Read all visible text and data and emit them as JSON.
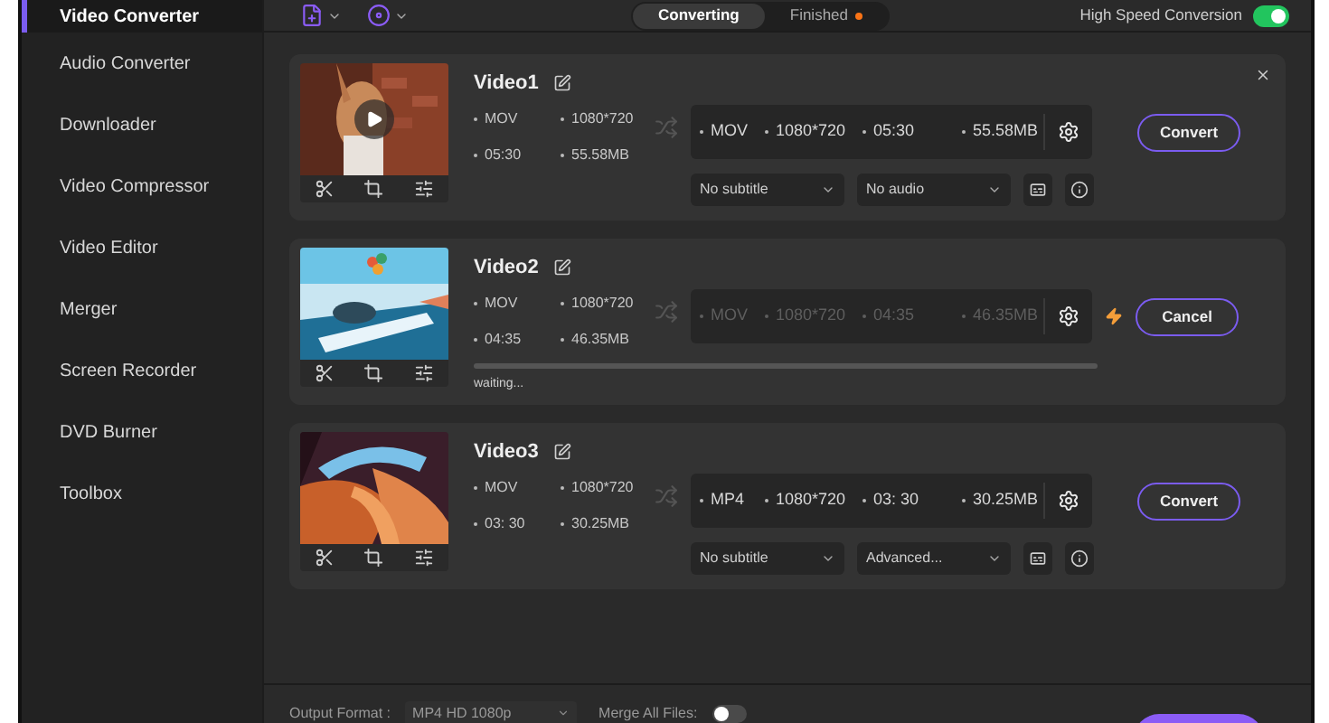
{
  "sidebar": {
    "items": [
      {
        "label": "Video Converter",
        "selected": true
      },
      {
        "label": "Audio Converter",
        "selected": false
      },
      {
        "label": "Downloader",
        "selected": false
      },
      {
        "label": "Video Compressor",
        "selected": false
      },
      {
        "label": "Video Editor",
        "selected": false
      },
      {
        "label": "Merger",
        "selected": false
      },
      {
        "label": "Screen Recorder",
        "selected": false
      },
      {
        "label": "DVD Burner",
        "selected": false
      },
      {
        "label": "Toolbox",
        "selected": false
      }
    ]
  },
  "toolbar": {
    "tabs": [
      {
        "label": "Converting",
        "selected": true,
        "badge": false
      },
      {
        "label": "Finished",
        "selected": false,
        "badge": true
      }
    ],
    "high_speed": {
      "label": "High Speed Conversion",
      "on": true
    }
  },
  "videos": [
    {
      "kind": "idle",
      "title": "Video1",
      "closable": true,
      "playing_overlay": true,
      "source": {
        "format": "MOV",
        "resolution": "1080*720",
        "duration": "05:30",
        "size": "55.58MB"
      },
      "target": {
        "format": "MOV",
        "resolution": "1080*720",
        "duration": "05:30",
        "size": "55.58MB"
      },
      "subtitle": "No subtitle",
      "audio": "No audio",
      "button": "Convert"
    },
    {
      "kind": "converting",
      "title": "Video2",
      "source": {
        "format": "MOV",
        "resolution": "1080*720",
        "duration": "04:35",
        "size": "46.35MB"
      },
      "target": {
        "format": "MOV",
        "resolution": "1080*720",
        "duration": "04:35",
        "size": "46.35MB"
      },
      "status": "waiting...",
      "level": 0,
      "accelerated": true,
      "button": "Cancel"
    },
    {
      "kind": "idle",
      "title": "Video3",
      "source": {
        "format": "MOV",
        "resolution": "1080*720",
        "duration": "03: 30",
        "size": "30.25MB"
      },
      "target": {
        "format": "MP4",
        "resolution": "1080*720",
        "duration": "03: 30",
        "size": "30.25MB"
      },
      "subtitle": "No subtitle",
      "audio": "Advanced...",
      "button": "Convert"
    }
  ],
  "footer": {
    "output_label": "Output Format :",
    "output_value": "MP4 HD 1080p",
    "merge_label": "Merge All Files:",
    "merge_on": false
  }
}
